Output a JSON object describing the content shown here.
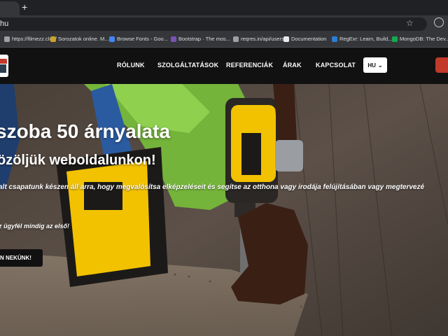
{
  "browser": {
    "tab_close_glyph": "×",
    "new_tab_glyph": "+",
    "address": "hu",
    "star_glyph": "☆",
    "bookmarks": [
      {
        "label": "https://filmezz.club/",
        "icon": "page-icon",
        "color": "#9aa0a6"
      },
      {
        "label": "Sorozatok online. M...",
        "icon": "site-icon",
        "color": "#c9a227"
      },
      {
        "label": "Browse Fonts - Goo...",
        "icon": "google-fonts-icon",
        "color": "#4285f4"
      },
      {
        "label": "Bootstrap · The mos...",
        "icon": "bootstrap-icon",
        "color": "#7952b3"
      },
      {
        "label": "reqres.in/api/users",
        "icon": "globe-icon",
        "color": "#9aa0a6"
      },
      {
        "label": "Documentation",
        "icon": "github-icon",
        "color": "#e8eaed"
      },
      {
        "label": "RegExr: Learn, Build,...",
        "icon": "regexr-icon",
        "color": "#2e7dd1"
      },
      {
        "label": "MongoDB: The Dev...",
        "icon": "mongodb-icon",
        "color": "#13aa52"
      }
    ]
  },
  "nav": {
    "items": [
      "RÓLUNK",
      "SZOLGÁLTATÁSOK",
      "REFERENCIÁK",
      "ÁRAK",
      "KAPCSOLAT"
    ],
    "lang": "HU",
    "lang_arrow": "⌄"
  },
  "hero": {
    "title": "szoba 50 árnyalata",
    "subtitle": "özöljük weboldalunkon!",
    "text": "alt csapatunk készen áll arra, hogy megvalósítsa elképzeléseit és segítse az otthona vagy irodája felújításában vagy megtervezé",
    "motto": "z ügyfél mindig az első!",
    "button": "N NEKÜNK!"
  },
  "colors": {
    "navbar": "#111111",
    "accent_red": "#c0392b",
    "glove_green": "#8fd14f",
    "drill_yellow": "#f2c200"
  }
}
